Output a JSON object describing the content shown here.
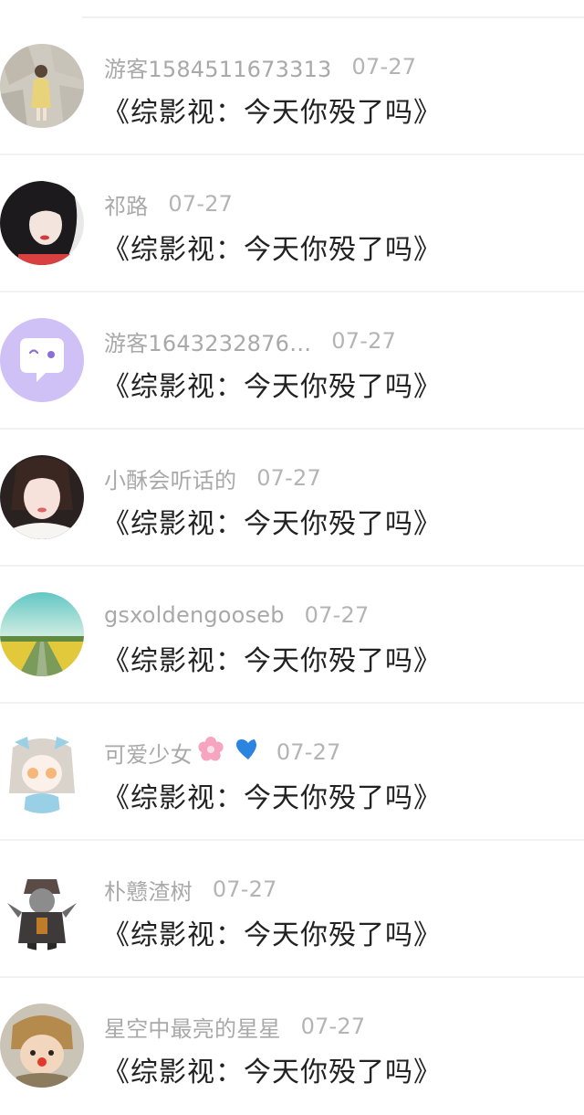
{
  "comments": [
    {
      "user": "游客1584511673313",
      "date": "07-27",
      "title": "《综影视：今天你殁了吗》",
      "avatar": "girl-by-wall-avatar"
    },
    {
      "user": "祁路",
      "date": "07-27",
      "title": "《综影视：今天你殁了吗》",
      "avatar": "dark-hair-girl-avatar"
    },
    {
      "user": "游客1643232876…",
      "date": "07-27",
      "title": "《综影视：今天你殁了吗》",
      "avatar": "default-chat-bubble-avatar"
    },
    {
      "user": "小酥会听话的",
      "date": "07-27",
      "title": "《综影视：今天你殁了吗》",
      "avatar": "smiling-girl-avatar"
    },
    {
      "user": "gsxoldengooseb",
      "date": "07-27",
      "title": "《综影视：今天你殁了吗》",
      "avatar": "field-landscape-avatar"
    },
    {
      "user": "可爱少女",
      "user_emoji": "🌸 💙",
      "date": "07-27",
      "title": "《综影视：今天你殁了吗》",
      "avatar": "anime-girl-avatar"
    },
    {
      "user": "朴戆渣树",
      "date": "07-27",
      "title": "《综影视：今天你殁了吗》",
      "avatar": "armored-figure-avatar"
    },
    {
      "user": "星空中最亮的星星",
      "date": "07-27",
      "title": "《综影视：今天你殁了吗》",
      "avatar": "doll-figure-avatar"
    }
  ],
  "colors": {
    "username": "#a9a9a9",
    "title": "#222222",
    "divider": "#f1f1f1",
    "default_avatar_bg": "#cfc0f5"
  }
}
